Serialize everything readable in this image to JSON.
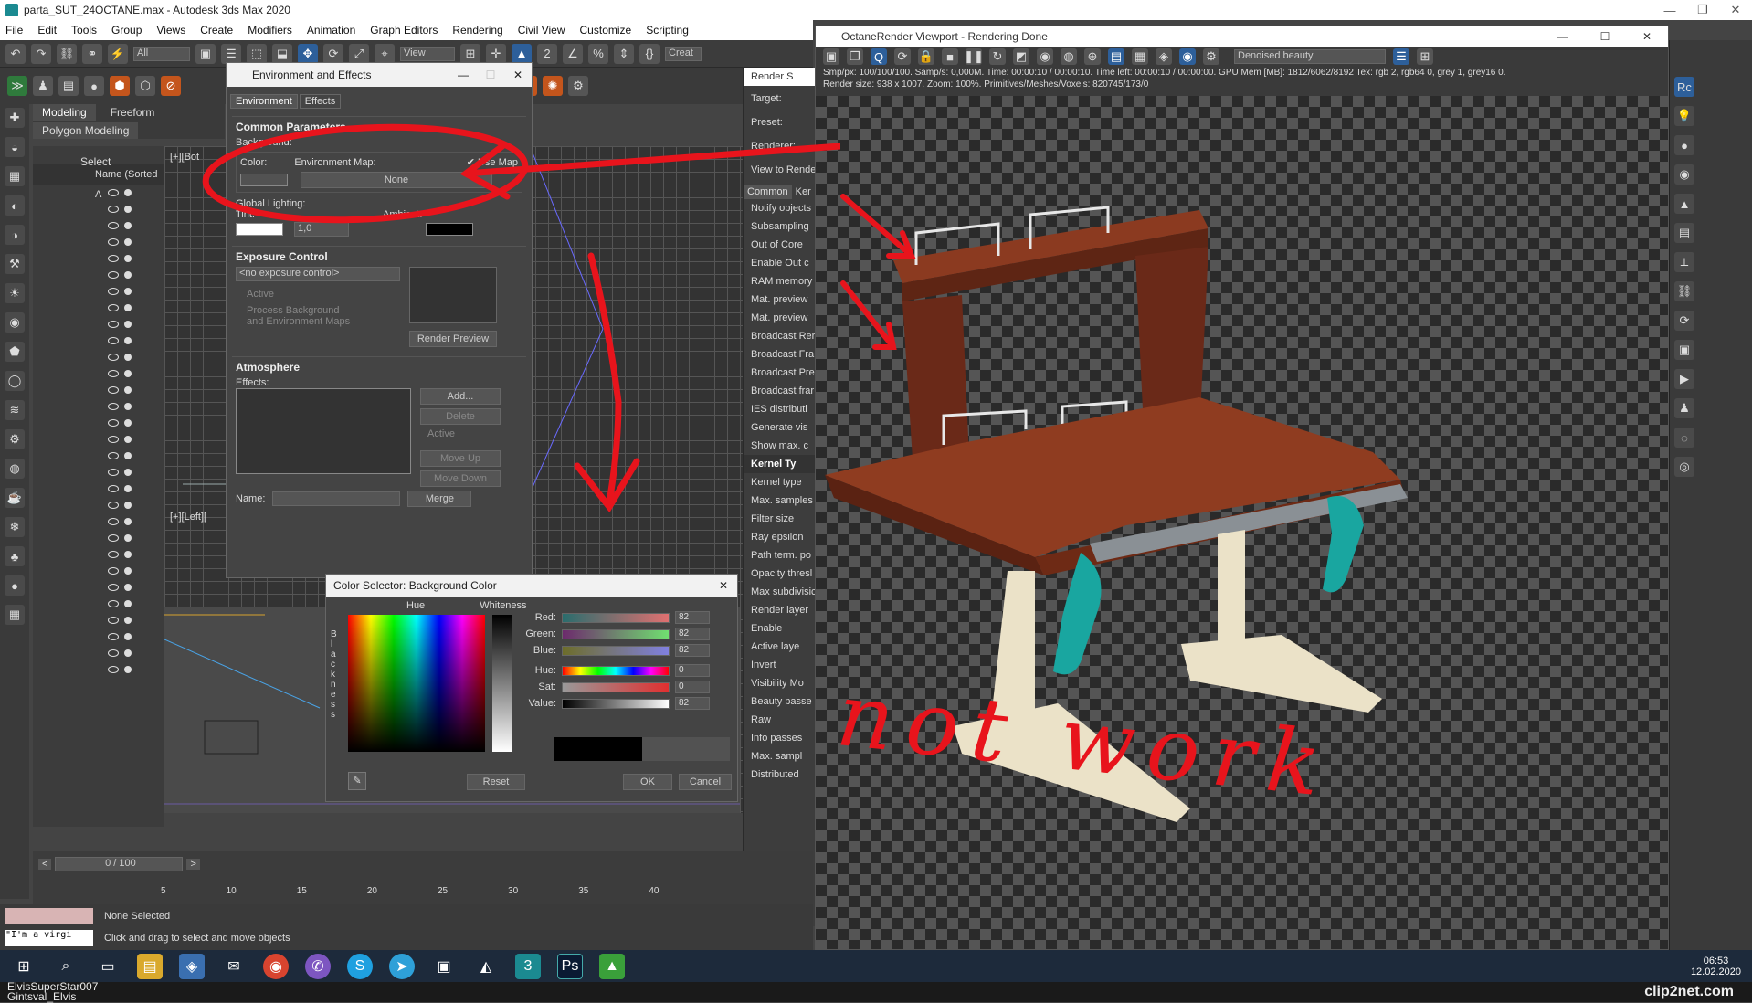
{
  "window": {
    "title": "parta_SUT_24OCTANE.max - Autodesk 3ds Max 2020"
  },
  "menu": [
    "File",
    "Edit",
    "Tools",
    "Group",
    "Views",
    "Create",
    "Modifiers",
    "Animation",
    "Graph Editors",
    "Rendering",
    "Civil View",
    "Customize",
    "Scripting"
  ],
  "toolbar": {
    "selection_filter": "All",
    "view_dropdown": "View",
    "create_label": "Creat"
  },
  "ribbon": {
    "tabs": [
      "Modeling",
      "Freeform"
    ],
    "subtitle": "Polygon Modeling"
  },
  "scene_explorer": {
    "select_label": "Select",
    "column_header": "Name (Sorted A"
  },
  "viewport_labels": {
    "top": "[+][Bot",
    "left": "[+][Left]["
  },
  "env_dialog": {
    "title": "Environment and Effects",
    "tabs": [
      "Environment",
      "Effects"
    ],
    "common_params": "Common Parameters",
    "background": "Background:",
    "color_label": "Color:",
    "env_map_label": "Environment Map:",
    "use_map": "Use Map",
    "env_map_value": "None",
    "global_lighting": "Global Lighting:",
    "tint": "Tint:",
    "level_value": "1,0",
    "ambient": "Ambient:",
    "exposure_title": "Exposure Control",
    "exposure_select": "<no exposure control>",
    "active": "Active",
    "process_bg": "Process Background",
    "process_bg2": "and Environment Maps",
    "render_preview": "Render Preview",
    "atmosphere_title": "Atmosphere",
    "effects_label": "Effects:",
    "add": "Add...",
    "delete": "Delete",
    "active2": "Active",
    "move_up": "Move Up",
    "move_down": "Move Down",
    "name_label": "Name:",
    "merge": "Merge"
  },
  "color_dialog": {
    "title": "Color Selector: Background Color",
    "hue": "Hue",
    "whiteness": "Whiteness",
    "blackness": "B l a c k n e s s",
    "rows": [
      {
        "label": "Red:",
        "value": "82"
      },
      {
        "label": "Green:",
        "value": "82"
      },
      {
        "label": "Blue:",
        "value": "82"
      },
      {
        "label": "Hue:",
        "value": "0"
      },
      {
        "label": "Sat:",
        "value": "0"
      },
      {
        "label": "Value:",
        "value": "82"
      }
    ],
    "reset": "Reset",
    "ok": "OK",
    "cancel": "Cancel"
  },
  "render_setup": {
    "title": "Render S",
    "target": "Target:",
    "preset": "Preset:",
    "renderer": "Renderer:",
    "view": "View to Rende",
    "tab1": "Common",
    "tab2": "Ker",
    "items": [
      "Notify objects",
      "Subsampling",
      "Out of Core",
      "Enable Out c",
      "RAM memory",
      "Mat. preview",
      "Mat. preview",
      "Broadcast Rer",
      "Broadcast Fra",
      "Broadcast Pre",
      "Broadcast frar",
      "IES distributi",
      "Generate vis",
      "Show max. c"
    ],
    "kernel_header": "Kernel Ty",
    "kernel_items": [
      "Kernel type",
      "Max. samples",
      "Filter size",
      "Ray epsilon",
      "Path term. po",
      "Opacity thresl",
      "Max subdivisic",
      "Render layer",
      "Enable",
      "Active laye",
      "Invert",
      "Visibility Mo",
      "Beauty passe",
      "Raw",
      "Info passes",
      "Max. sampl",
      "Distributed"
    ]
  },
  "octane": {
    "title": "OctaneRender Viewport - Rendering Done",
    "pass_select": "Denoised beauty",
    "stats1": "Smp/px: 100/100/100.  Samp/s: 0,000M.  Time: 00:00:10 / 00:00:10.  Time left: 00:00:10 / 00:00:00.  GPU Mem [MB]: 1812/6062/8192  Tex: rgb 2, rgb64 0, grey 1, grey16 0.",
    "stats2": "Render size: 938 x 1007.  Zoom: 100%.  Primitives/Meshes/Voxels: 820745/173/0"
  },
  "annotation": {
    "text": "not work",
    "color": "#e8141c"
  },
  "timeline": {
    "frame": "0 / 100",
    "ticks": [
      "5",
      "10",
      "15",
      "20",
      "25",
      "30",
      "35",
      "40"
    ]
  },
  "status": {
    "selection": "None Selected",
    "hint": "Click and drag to select and move objects",
    "script": "\"I'm a virgi"
  },
  "taskbar": {
    "time": "06:53",
    "date": "12.02.2020"
  },
  "footer": {
    "user1": "ElvisSuperStar007",
    "user2": "Gintsval_Elvis",
    "watermark": "clip2net.com"
  },
  "colors": {
    "accent_blue": "#2d5f9a",
    "desk_wood": "#7a2e1c",
    "teal": "#19a6a0",
    "cream": "#ebe2c8"
  }
}
